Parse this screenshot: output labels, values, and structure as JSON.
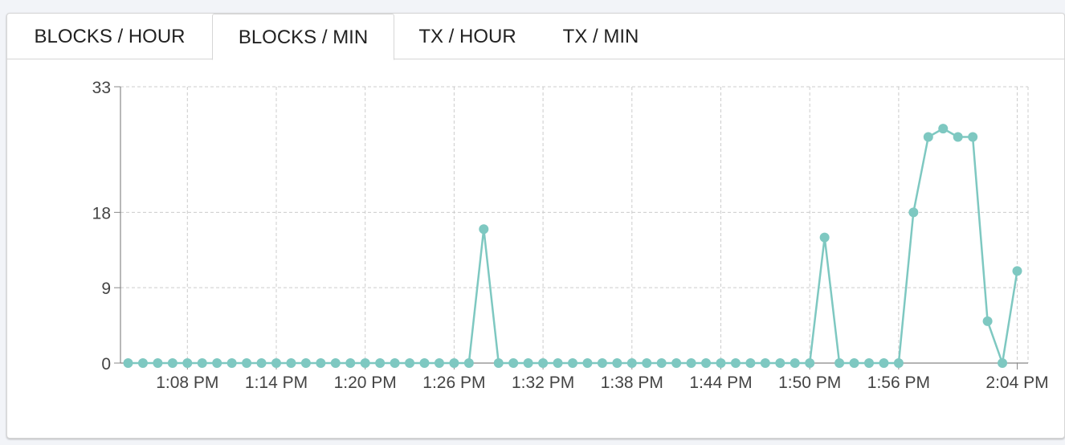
{
  "tabs": [
    {
      "label": "BLOCKS / HOUR",
      "active": false
    },
    {
      "label": "BLOCKS / MIN",
      "active": true
    },
    {
      "label": "TX / HOUR",
      "active": false
    },
    {
      "label": "TX / MIN",
      "active": false
    }
  ],
  "colors": {
    "series": "#7ec8c1",
    "grid": "#cccccc",
    "axis": "#888888"
  },
  "chart_data": {
    "type": "line",
    "title": "",
    "xlabel": "",
    "ylabel": "",
    "ylim": [
      0,
      33
    ],
    "yticks": [
      0,
      9,
      18,
      33
    ],
    "xticks": [
      "1:08 PM",
      "1:14 PM",
      "1:20 PM",
      "1:26 PM",
      "1:32 PM",
      "1:38 PM",
      "1:44 PM",
      "1:50 PM",
      "1:56 PM",
      "2:04 PM"
    ],
    "x_minutes": [
      64,
      65,
      66,
      67,
      68,
      69,
      70,
      71,
      72,
      73,
      74,
      75,
      76,
      77,
      78,
      79,
      80,
      81,
      82,
      83,
      84,
      85,
      86,
      87,
      88,
      89,
      90,
      91,
      92,
      93,
      94,
      95,
      96,
      97,
      98,
      99,
      100,
      101,
      102,
      103,
      104,
      105,
      106,
      107,
      108,
      109,
      110,
      111,
      112,
      113,
      114,
      115,
      116,
      117,
      118,
      119,
      120,
      121,
      122,
      123,
      124,
      125
    ],
    "grid": true,
    "series": [
      {
        "values": [
          0,
          0,
          0,
          0,
          0,
          0,
          0,
          0,
          0,
          0,
          0,
          0,
          0,
          0,
          0,
          0,
          0,
          0,
          0,
          0,
          0,
          0,
          0,
          0,
          16,
          0,
          0,
          0,
          0,
          0,
          0,
          0,
          0,
          0,
          0,
          0,
          0,
          0,
          0,
          0,
          0,
          0,
          0,
          0,
          0,
          0,
          0,
          15,
          0,
          0,
          0,
          0,
          0,
          18,
          27,
          28,
          27,
          27,
          5,
          0,
          11
        ]
      }
    ]
  }
}
